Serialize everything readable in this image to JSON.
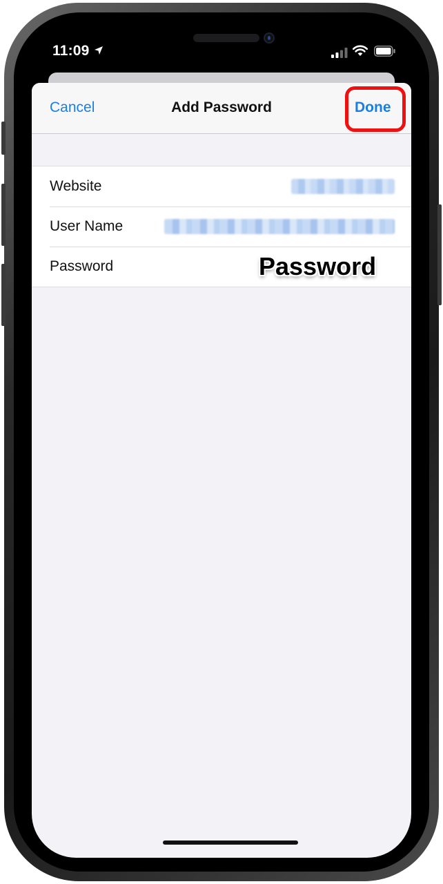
{
  "status_bar": {
    "time": "11:09",
    "icons": [
      "location-arrow-icon",
      "cellular-signal-icon",
      "wifi-icon",
      "battery-icon"
    ]
  },
  "navbar": {
    "cancel_label": "Cancel",
    "title": "Add Password",
    "done_label": "Done"
  },
  "form": {
    "rows": [
      {
        "label": "Website"
      },
      {
        "label": "User Name"
      },
      {
        "label": "Password",
        "overlay_text": "Password"
      }
    ]
  },
  "colors": {
    "accent": "#1a7fe0",
    "highlight": "#ee1111",
    "sheet_bg": "#f2f2f7"
  }
}
